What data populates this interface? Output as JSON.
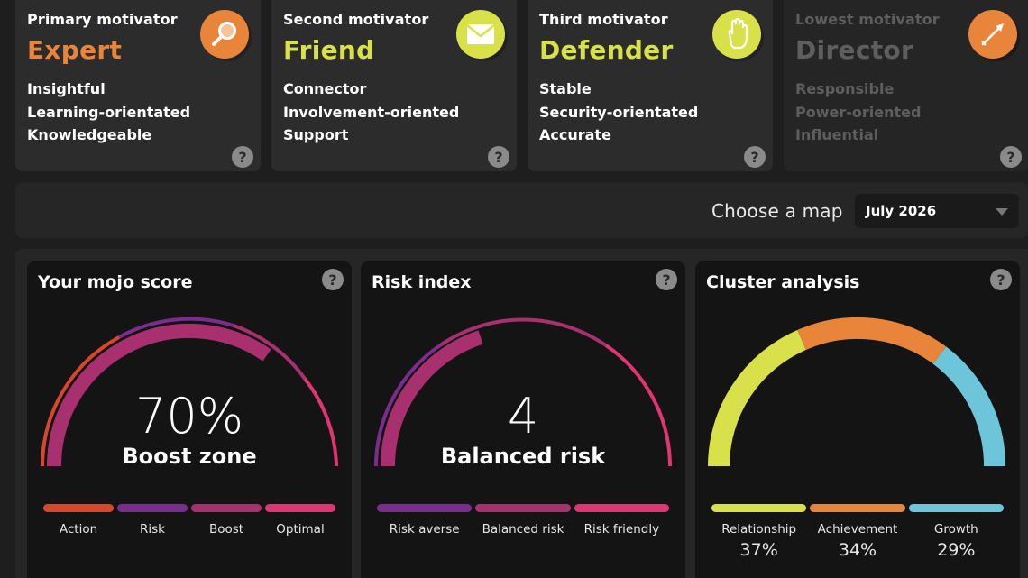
{
  "motivators": [
    {
      "rank": "Primary motivator",
      "name": "Expert",
      "color": "#e8853a",
      "traits": [
        "Insightful",
        "Learning-orientated",
        "Knowledgeable"
      ],
      "icon": "magnifier-icon",
      "icon_bg": "#e8853a",
      "dimmed": false
    },
    {
      "rank": "Second motivator",
      "name": "Friend",
      "color": "#d9e14a",
      "traits": [
        "Connector",
        "Involvement-oriented",
        "Support"
      ],
      "icon": "envelope-icon",
      "icon_bg": "#d9e14a",
      "dimmed": false
    },
    {
      "rank": "Third motivator",
      "name": "Defender",
      "color": "#d9e14a",
      "traits": [
        "Stable",
        "Security-orientated",
        "Accurate"
      ],
      "icon": "hand-icon",
      "icon_bg": "#d9e14a",
      "dimmed": false
    },
    {
      "rank": "Lowest motivator",
      "name": "Director",
      "color": "#5e5e5e",
      "traits": [
        "Responsible",
        "Power-oriented",
        "Influential"
      ],
      "icon": "arrow-icon",
      "icon_bg": "#e8853a",
      "dimmed": true
    }
  ],
  "map_selector": {
    "label": "Choose a map",
    "selected": "July 2026"
  },
  "mojo": {
    "title": "Your mojo score",
    "value": "70%",
    "zone": "Boost zone",
    "level": 0.7,
    "legend": [
      {
        "label": "Action",
        "color": "#d9472b"
      },
      {
        "label": "Risk",
        "color": "#7a2d8f"
      },
      {
        "label": "Boost",
        "color": "#a8306e"
      },
      {
        "label": "Optimal",
        "color": "#e03573"
      }
    ]
  },
  "risk": {
    "title": "Risk index",
    "value": "4",
    "zone": "Balanced risk",
    "legend": [
      {
        "label": "Risk averse",
        "color": "#7a2d8f"
      },
      {
        "label": "Balanced risk",
        "color": "#a8306e"
      },
      {
        "label": "Risk friendly",
        "color": "#e03573"
      }
    ]
  },
  "cluster": {
    "title": "Cluster analysis",
    "legend": [
      {
        "label": "Relationship",
        "pct": "37%",
        "value": 37,
        "color": "#d9e14a"
      },
      {
        "label": "Achievement",
        "pct": "34%",
        "value": 34,
        "color": "#e8853a"
      },
      {
        "label": "Growth",
        "pct": "29%",
        "value": 29,
        "color": "#6cc5d9"
      }
    ]
  },
  "help_symbol": "?"
}
